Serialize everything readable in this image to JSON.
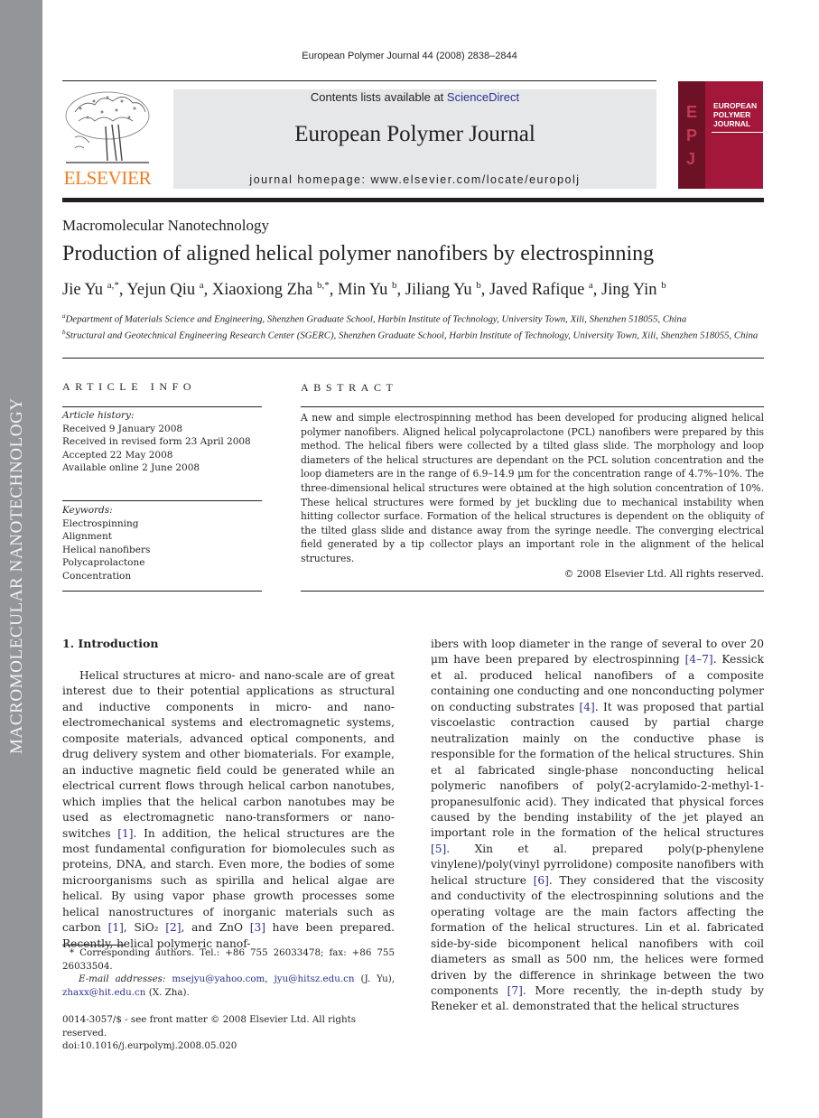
{
  "side_band": {
    "text": "MACROMOLECULAR NANOTECHNOLOGY"
  },
  "header": {
    "running_head": "European Polymer Journal 44 (2008) 2838–2844",
    "publisher_logo": "ELSEVIER",
    "contents_prefix": "Contents lists available at ",
    "contents_link": "ScienceDirect",
    "journal_name": "European Polymer Journal",
    "homepage": "journal homepage: www.elsevier.com/locate/europolj",
    "cover": {
      "letters": [
        "E",
        "P",
        "J"
      ],
      "title_lines": [
        "EUROPEAN",
        "POLYMER",
        "JOURNAL"
      ]
    }
  },
  "article": {
    "section": "Macromolecular Nanotechnology",
    "title": "Production of aligned helical polymer nanofibers by electrospinning",
    "authors": [
      {
        "name": "Jie Yu",
        "sup": "a,*"
      },
      {
        "name": "Yejun Qiu",
        "sup": "a"
      },
      {
        "name": "Xiaoxiong Zha",
        "sup": "b,*"
      },
      {
        "name": "Min Yu",
        "sup": "b"
      },
      {
        "name": "Jiliang Yu",
        "sup": "b"
      },
      {
        "name": "Javed Rafique",
        "sup": "a"
      },
      {
        "name": "Jing Yin",
        "sup": "b"
      }
    ],
    "affiliations": [
      {
        "sup": "a",
        "text": "Department of Materials Science and Engineering, Shenzhen Graduate School, Harbin Institute of Technology, University Town, Xili, Shenzhen 518055, China"
      },
      {
        "sup": "b",
        "text": "Structural and Geotechnical Engineering Research Center (SGERC), Shenzhen Graduate School, Harbin Institute of Technology, University Town, Xili, Shenzhen 518055, China"
      }
    ]
  },
  "article_info": {
    "heading": "ARTICLE INFO",
    "history_label": "Article history:",
    "history": [
      "Received 9 January 2008",
      "Received in revised form 23 April 2008",
      "Accepted 22 May 2008",
      "Available online 2 June 2008"
    ],
    "keywords_label": "Keywords:",
    "keywords": [
      "Electrospinning",
      "Alignment",
      "Helical nanofibers",
      "Polycaprolactone",
      "Concentration"
    ]
  },
  "abstract": {
    "heading": "ABSTRACT",
    "text": "A new and simple electrospinning method has been developed for producing aligned helical polymer nanofibers. Aligned helical polycaprolactone (PCL) nanofibers were prepared by this method. The helical fibers were collected by a tilted glass slide. The morphology and loop diameters of the helical structures are dependant on the PCL solution concentration and the loop diameters are in the range of 6.9–14.9 μm for the concentration range of 4.7%–10%. The three-dimensional helical structures were obtained at the high solution concentration of 10%. These helical structures were formed by jet buckling due to mechanical instability when hitting collector surface. Formation of the helical structures is dependent on the obliquity of the tilted glass slide and distance away from the syringe needle. The converging electrical field generated by a tip collector plays an important role in the alignment of the helical structures.",
    "copyright": "© 2008 Elsevier Ltd. All rights reserved."
  },
  "introduction": {
    "heading": "1.  Introduction",
    "left_segments": [
      {
        "t": "Helical structures at micro- and nano-scale are of great interest due to their potential applications as structural and inductive components in micro- and nano-electromechanical systems and electromagnetic systems, composite materials, advanced optical components, and drug delivery system and other biomaterials. For example, an inductive magnetic field could be generated while an electrical current flows through helical carbon nanotubes, which implies that the helical carbon nanotubes may be used as electromagnetic nano-transformers or nano-switches "
      },
      {
        "ref": "[1]"
      },
      {
        "t": ". In addition, the helical structures are the most fundamental configuration for biomolecules such as proteins, DNA, and starch. Even more, the bodies of some microorganisms such as spirilla and helical algae are helical. By using vapor phase growth processes some helical nanostructures of inorganic materials such as carbon "
      },
      {
        "ref": "[1]"
      },
      {
        "t": ", SiO₂ "
      },
      {
        "ref": "[2]"
      },
      {
        "t": ", and ZnO "
      },
      {
        "ref": "[3]"
      },
      {
        "t": " have been prepared. Recently, helical polymeric nanof-"
      }
    ],
    "right_segments": [
      {
        "t": "ibers with loop diameter in the range of several to over 20 μm have been prepared by electrospinning "
      },
      {
        "ref": "[4–7]"
      },
      {
        "t": ". Kessick et al. produced helical nanofibers of a composite containing one conducting and one nonconducting polymer on conducting substrates "
      },
      {
        "ref": "[4]"
      },
      {
        "t": ". It was proposed that partial viscoelastic contraction caused by partial charge neutralization mainly on the conductive phase is responsible for the formation of the helical structures. Shin et al fabricated single-phase nonconducting helical polymeric nanofibers of poly(2-acrylamido-2-methyl-1-propanesulfonic acid). They indicated that physical forces caused by the bending instability of the jet played an important role in the formation of the helical structures "
      },
      {
        "ref": "[5]"
      },
      {
        "t": ". Xin et al. prepared poly(p-phenylene vinylene)/poly(vinyl pyrrolidone) composite nanofibers with helical structure "
      },
      {
        "ref": "[6]"
      },
      {
        "t": ". They considered that the viscosity and conductivity of the electrospinning solutions and the operating voltage are the main factors affecting the formation of the helical structures. Lin et al. fabricated side-by-side bicomponent helical nanofibers with coil diameters as small as 500 nm, the helices were formed driven by the difference in shrinkage between the two components "
      },
      {
        "ref": "[7]"
      },
      {
        "t": ". More recently, the in-depth study by Reneker et al. demonstrated that the helical structures"
      }
    ]
  },
  "footnote": {
    "corresponding": "* Corresponding authors. Tel.: +86 755 26033478; fax: +86 755 26033504.",
    "email_label": "E-mail addresses: ",
    "email1": "msejyu@yahoo.com",
    "email2": "jyu@hitsz.edu.cn",
    "email2_owner": " (J. Yu), ",
    "email3": "zhaxx@hit.edu.cn",
    "email3_owner": " (X. Zha)."
  },
  "issn": {
    "line1": "0014-3057/$ - see front matter © 2008 Elsevier Ltd. All rights reserved.",
    "doi": "doi:10.1016/j.eurpolymj.2008.05.020"
  },
  "colors": {
    "link": "#2e3192",
    "elsevier_orange": "#f47d20",
    "cover_red": "#a3173b",
    "band_grey": "#939598"
  }
}
